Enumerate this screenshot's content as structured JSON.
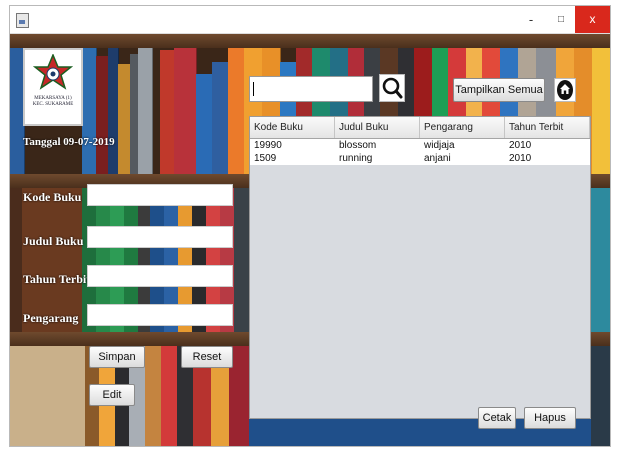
{
  "window": {
    "minimize_glyph": "-",
    "maximize_glyph": "□",
    "close_glyph": "x"
  },
  "sidebar": {
    "logo_text": "MEKARSAYA (1)",
    "logo_subtext": "KEC. SUKARAME",
    "date_label": "Tanggal 09-07-2019"
  },
  "form": {
    "kode_label": "Kode Buku",
    "judul_label": "Judul Buku",
    "tahun_label": "Tahun Terbit",
    "pengarang_label": "Pengarang",
    "kode_value": "",
    "judul_value": "",
    "tahun_value": "",
    "pengarang_value": ""
  },
  "buttons": {
    "simpan": "Simpan",
    "reset": "Reset",
    "edit": "Edit",
    "tampilkan_semua": "Tampilkan Semua",
    "cetak": "Cetak",
    "hapus": "Hapus"
  },
  "search": {
    "value": ""
  },
  "table": {
    "columns": [
      "Kode Buku",
      "Judul Buku",
      "Pengarang",
      "Tahun Terbit"
    ],
    "rows": [
      [
        "19990",
        "blossom",
        "widjaja",
        "2010"
      ],
      [
        "1509",
        "running",
        "anjani",
        "2010"
      ]
    ]
  }
}
